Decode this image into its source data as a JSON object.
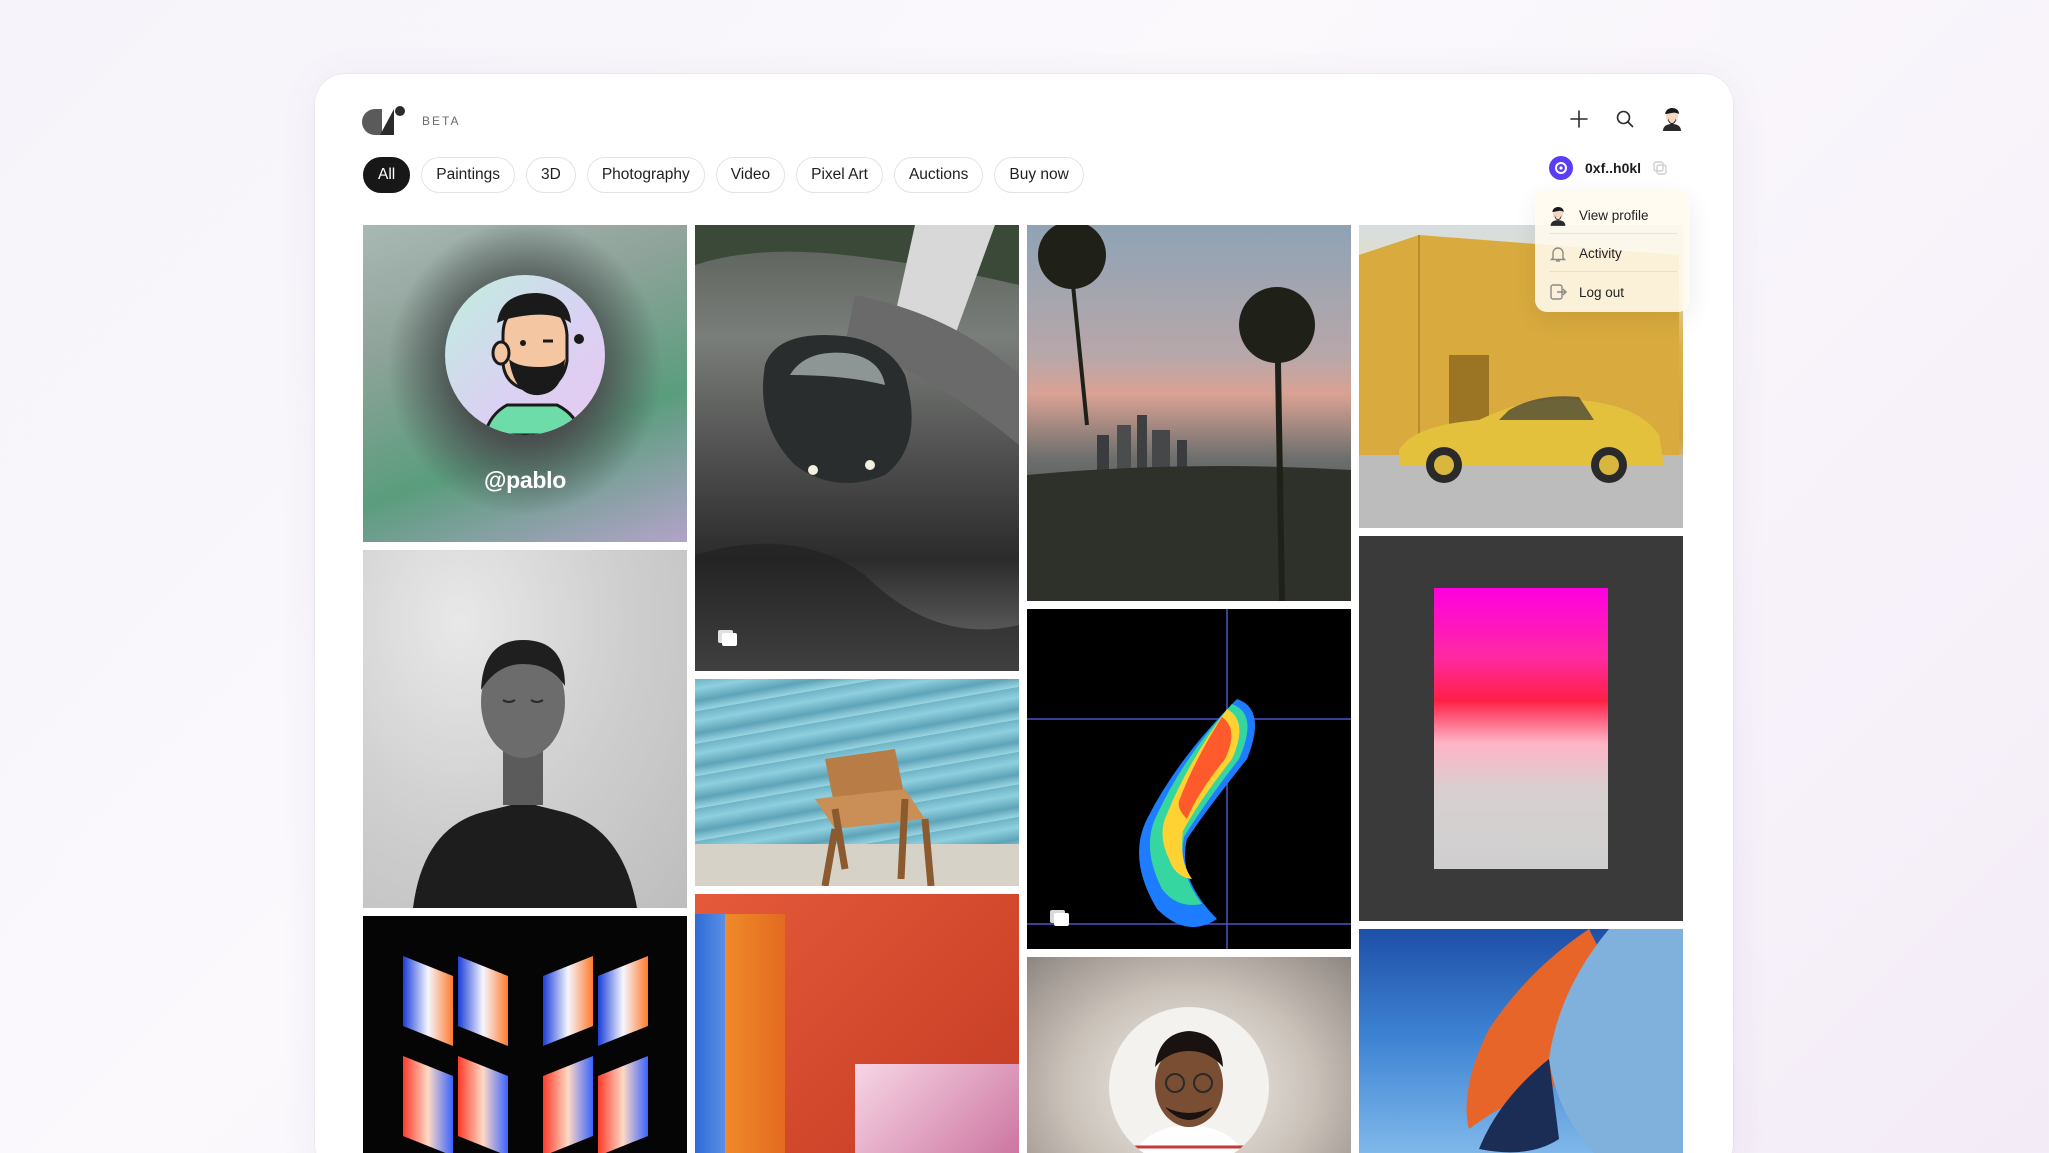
{
  "header": {
    "beta_label": "BETA"
  },
  "filters": [
    {
      "label": "All",
      "active": true
    },
    {
      "label": "Paintings"
    },
    {
      "label": "3D"
    },
    {
      "label": "Photography"
    },
    {
      "label": "Video"
    },
    {
      "label": "Pixel Art"
    },
    {
      "label": "Auctions"
    },
    {
      "label": "Buy now"
    }
  ],
  "wallet": {
    "address": "0xf..h0kl"
  },
  "menu": {
    "view_profile": "View profile",
    "activity": "Activity",
    "log_out": "Log out"
  },
  "profile_tile": {
    "handle": "@pablo"
  },
  "colors": {
    "accent": "#171717",
    "wallet_coin": "#5b3df5"
  }
}
